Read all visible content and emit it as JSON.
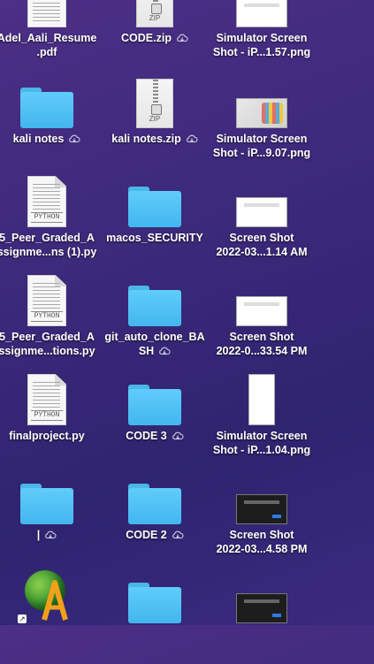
{
  "desktop": {
    "items": [
      {
        "label": "Adel_Aali_Resume\n.pdf",
        "icon": "pdf-document-icon",
        "cloud": false
      },
      {
        "label": "CODE.zip",
        "icon": "zip-archive-icon",
        "cloud": true
      },
      {
        "label": "Simulator Screen\nShot - iP...1.57.png",
        "icon": "screenshot-thumbnail-icon",
        "cloud": false
      },
      {
        "label": "kali notes",
        "icon": "folder-icon",
        "cloud": true
      },
      {
        "label": "kali notes.zip",
        "icon": "zip-archive-icon",
        "cloud": true
      },
      {
        "label": "Simulator Screen\nShot - iP...9.07.png",
        "icon": "screenshot-thumbnail-icon",
        "cloud": false
      },
      {
        "label": "5_Peer_Graded_A\nssignme...ns (1).py",
        "icon": "python-file-icon",
        "cloud": false
      },
      {
        "label": "macos_SECURITY",
        "icon": "folder-icon",
        "cloud": false
      },
      {
        "label": "Screen Shot\n2022-03...1.14 AM",
        "icon": "screenshot-thumbnail-icon",
        "cloud": false
      },
      {
        "label": "5_Peer_Graded_A\nssignme...tions.py",
        "icon": "python-file-icon",
        "cloud": false
      },
      {
        "label": "git_auto_clone_BA\nSH",
        "icon": "folder-icon",
        "cloud": true
      },
      {
        "label": "Screen Shot\n2022-0...33.54 PM",
        "icon": "screenshot-thumbnail-icon",
        "cloud": false
      },
      {
        "label": "finalproject.py",
        "icon": "python-file-icon",
        "cloud": false
      },
      {
        "label": "CODE 3",
        "icon": "folder-icon",
        "cloud": true
      },
      {
        "label": "Simulator Screen\nShot - iP...1.04.png",
        "icon": "screenshot-thumbnail-icon",
        "cloud": false
      },
      {
        "label": "|",
        "icon": "folder-icon",
        "cloud": true
      },
      {
        "label": "CODE 2",
        "icon": "folder-icon",
        "cloud": true
      },
      {
        "label": "Screen Shot\n2022-03...4.58 PM",
        "icon": "screenshot-thumbnail-icon",
        "cloud": false
      },
      {
        "label": "",
        "icon": "app-alias-globe-icon",
        "cloud": false
      },
      {
        "label": "",
        "icon": "folder-icon",
        "cloud": false
      },
      {
        "label": "",
        "icon": "screenshot-thumbnail-icon",
        "cloud": false
      }
    ],
    "colors": {
      "folder": "#4fc0f5",
      "background": "#3b2a7d"
    }
  }
}
